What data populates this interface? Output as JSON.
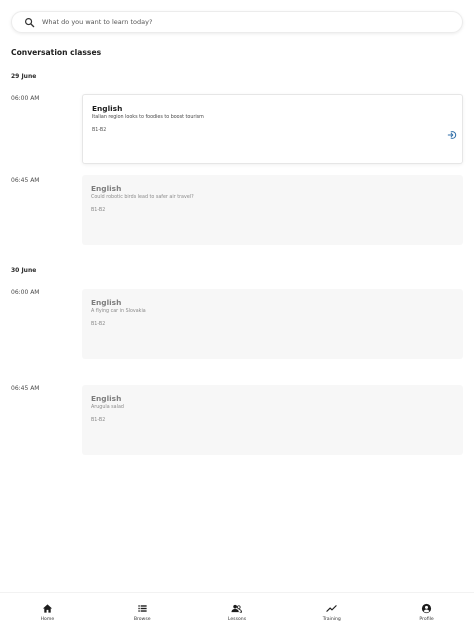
{
  "search": {
    "placeholder": "What do you want to learn today?"
  },
  "section_title": "Conversation classes",
  "days": [
    {
      "date": "29 June",
      "slots": [
        {
          "time": "06:00 AM",
          "language": "English",
          "topic": "Italian region looks to foodies to boost tourism",
          "level": "B1-B2",
          "state": "active"
        },
        {
          "time": "06:45 AM",
          "language": "English",
          "topic": "Could robotic birds lead to safer air travel?",
          "level": "B1-B2",
          "state": "past"
        }
      ]
    },
    {
      "date": "30 June",
      "slots": [
        {
          "time": "06:00 AM",
          "language": "English",
          "topic": "A flying car in Slovakia",
          "level": "B1-B2",
          "state": "past"
        },
        {
          "time": "06:45 AM",
          "language": "English",
          "topic": "Arugula salad",
          "level": "B1-B2",
          "state": "past"
        }
      ]
    }
  ],
  "bottom_nav": [
    {
      "label": "Home",
      "icon": "home-icon"
    },
    {
      "label": "Browse",
      "icon": "list-icon"
    },
    {
      "label": "Lessons",
      "icon": "lessons-icon"
    },
    {
      "label": "Training",
      "icon": "trending-icon"
    },
    {
      "label": "Profile",
      "icon": "profile-icon"
    }
  ],
  "colors": {
    "accent": "#2f6ea8",
    "card_past_bg": "#f7f7f7",
    "text": "#1d1d1d"
  }
}
